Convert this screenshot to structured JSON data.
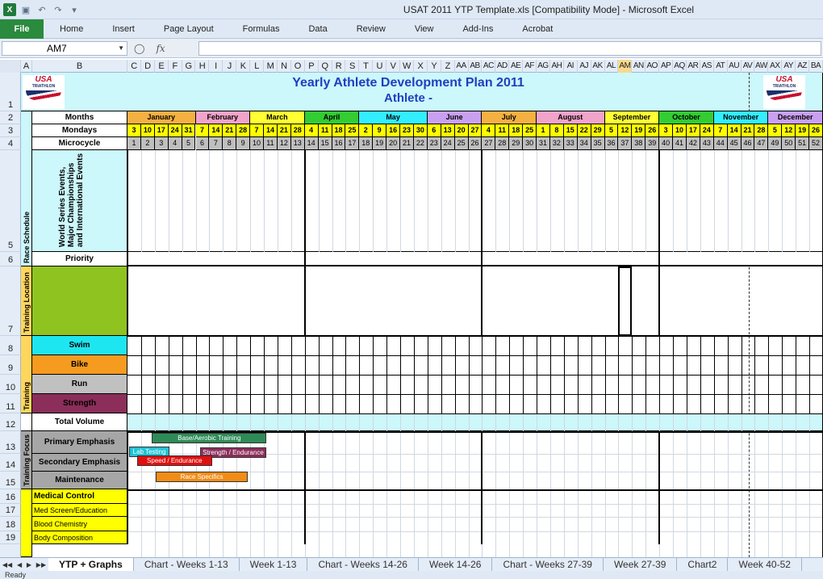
{
  "window": {
    "title": "USAT 2011 YTP Template.xls  [Compatibility Mode]  -  Microsoft Excel",
    "qat_icons": [
      "excel-logo-icon",
      "save-icon",
      "undo-icon",
      "redo-icon",
      "customize-icon"
    ]
  },
  "ribbon": {
    "file_tab": "File",
    "tabs": [
      "Home",
      "Insert",
      "Page Layout",
      "Formulas",
      "Data",
      "Review",
      "View",
      "Add-Ins",
      "Acrobat"
    ]
  },
  "formula_bar": {
    "name_box": "AM7",
    "fx_label": "fx",
    "formula": ""
  },
  "columns": [
    "A",
    "B",
    "C",
    "D",
    "E",
    "F",
    "G",
    "H",
    "I",
    "J",
    "K",
    "L",
    "M",
    "N",
    "O",
    "P",
    "Q",
    "R",
    "S",
    "T",
    "U",
    "V",
    "W",
    "X",
    "Y",
    "Z",
    "AA",
    "AB",
    "AC",
    "AD",
    "AE",
    "AF",
    "AG",
    "AH",
    "AI",
    "AJ",
    "AK",
    "AL",
    "AM",
    "AN",
    "AO",
    "AP",
    "AQ",
    "AR",
    "AS",
    "AT",
    "AU",
    "AV",
    "AW",
    "AX",
    "AY",
    "AZ",
    "BA"
  ],
  "selected_column": "AM",
  "rows": [
    "1",
    "2",
    "3",
    "4",
    "5",
    "6",
    "7",
    "8",
    "9",
    "10",
    "11",
    "12",
    "13",
    "14",
    "15",
    "16",
    "17",
    "18",
    "19"
  ],
  "plan": {
    "title": "Yearly Athlete  Development Plan 2011",
    "athlete": "Athlete  -",
    "logo_text": "USA TRIATHLON",
    "row_labels": {
      "months": "Months",
      "mondays": "Mondays",
      "microcycle": "Microcycle",
      "race_events": "World Series Events, Major Championships and International Events",
      "priority": "Priority",
      "swim": "Swim",
      "bike": "Bike",
      "run": "Run",
      "strength": "Strength",
      "total_volume": "Total Volume",
      "primary": "Primary Emphasis",
      "secondary": "Secondary Emphasis",
      "maintenance": "Maintenance",
      "medical": "Medical Control",
      "med_screen": "Med Screen/Education",
      "blood": "Blood Chemistry",
      "body": "Body Composition"
    },
    "section_labels": {
      "race_schedule": "Race Schedule",
      "training_location": "Training Location",
      "training": "Training",
      "training_focus": "Training Focus"
    },
    "months": [
      {
        "name": "January",
        "weeks": 5,
        "color": "#f5b042"
      },
      {
        "name": "February",
        "weeks": 4,
        "color": "#f2a3c9"
      },
      {
        "name": "March",
        "weeks": 4,
        "color": "#ffff33"
      },
      {
        "name": "April",
        "weeks": 4,
        "color": "#33cc33"
      },
      {
        "name": "May",
        "weeks": 5,
        "color": "#33eeff"
      },
      {
        "name": "June",
        "weeks": 4,
        "color": "#c9a0f0"
      },
      {
        "name": "July",
        "weeks": 4,
        "color": "#f5b042"
      },
      {
        "name": "August",
        "weeks": 5,
        "color": "#f2a3c9"
      },
      {
        "name": "September",
        "weeks": 4,
        "color": "#ffff33"
      },
      {
        "name": "October",
        "weeks": 4,
        "color": "#33cc33"
      },
      {
        "name": "November",
        "weeks": 4,
        "color": "#33eeff"
      },
      {
        "name": "December",
        "weeks": 4,
        "color": "#c9a0f0"
      }
    ],
    "mondays": [
      "3",
      "10",
      "17",
      "24",
      "31",
      "7",
      "14",
      "21",
      "28",
      "7",
      "14",
      "21",
      "28",
      "4",
      "11",
      "18",
      "25",
      "2",
      "9",
      "16",
      "23",
      "30",
      "6",
      "13",
      "20",
      "27",
      "4",
      "11",
      "18",
      "25",
      "1",
      "8",
      "15",
      "22",
      "29",
      "5",
      "12",
      "19",
      "26",
      "3",
      "10",
      "17",
      "24",
      "7",
      "14",
      "21",
      "28",
      "5",
      "12",
      "19",
      "26"
    ],
    "microcycles": [
      "1",
      "2",
      "3",
      "4",
      "5",
      "6",
      "7",
      "8",
      "9",
      "10",
      "11",
      "12",
      "13",
      "14",
      "15",
      "16",
      "17",
      "18",
      "19",
      "20",
      "21",
      "22",
      "23",
      "24",
      "25",
      "26",
      "27",
      "28",
      "29",
      "30",
      "31",
      "32",
      "33",
      "34",
      "35",
      "36",
      "37",
      "38",
      "39",
      "40",
      "41",
      "42",
      "43",
      "44",
      "45",
      "46",
      "47",
      "49",
      "50",
      "51",
      "52"
    ],
    "focus_bars": [
      {
        "label": "Base/Aerobic  Training",
        "color": "#2e8b57"
      },
      {
        "label": "Lab  Testing",
        "color": "#1fc3d6"
      },
      {
        "label": "Strength  / Endurance",
        "color": "#8b2e5a"
      },
      {
        "label": "Speed  / Endurance",
        "color": "#e01010"
      },
      {
        "label": "Race Specifics",
        "color": "#f28c16"
      }
    ]
  },
  "sheet_tabs": [
    "YTP + Graphs",
    "Chart - Weeks 1-13",
    "Week 1-13",
    "Chart - Weeks 14-26",
    "Week 14-26",
    "Chart - Weeks 27-39",
    "Week 27-39",
    "Chart2",
    "Week 40-52"
  ],
  "active_sheet": "YTP + Graphs",
  "status": "Ready"
}
